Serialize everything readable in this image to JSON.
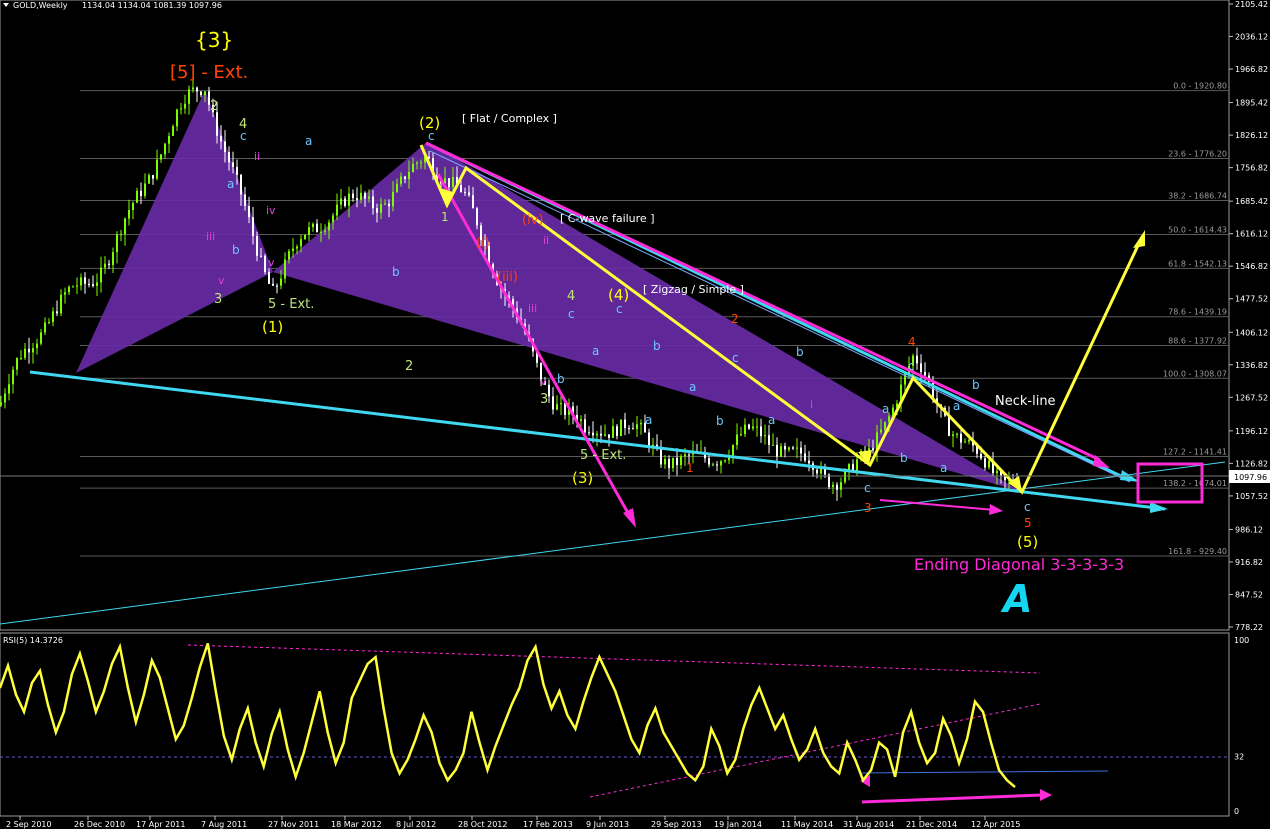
{
  "header": {
    "symbol": "GOLD,Weekly",
    "ohlc": "1134.04 1134.04 1081.39 1097.96"
  },
  "rsi_header": "RSI(5) 14.3726",
  "colors": {
    "bull": "#7CFC00",
    "fill": "#6A2BA8",
    "cyan": "#3FD8F0",
    "magenta": "#FF2AD8",
    "yellow": "#FFFF3A",
    "label_yellow": "#FFFF00",
    "label_orange": "#FF4400"
  },
  "chart_data": [
    {
      "type": "candlestick",
      "title": "GOLD,Weekly",
      "y_tick_labels": [
        "2105.42",
        "2036.12",
        "1966.82",
        "1895.42",
        "1826.12",
        "1756.82",
        "1685.42",
        "1616.12",
        "1546.82",
        "1477.52",
        "1406.12",
        "1336.82",
        "1267.52",
        "1196.12",
        "1126.82",
        "1057.52",
        "986.12",
        "916.82",
        "847.52",
        "778.22"
      ],
      "ylim": [
        778.22,
        2105.42
      ],
      "x_tick_labels": [
        "2 Sep 2010",
        "26 Dec 2010",
        "17 Apr 2011",
        "7 Aug 2011",
        "27 Nov 2011",
        "18 Mar 2012",
        "8 Jul 2012",
        "28 Oct 2012",
        "17 Feb 2013",
        "9 Jun 2013",
        "29 Sep 2013",
        "19 Jan 2014",
        "11 May 2014",
        "31 Aug 2014",
        "21 Dec 2014",
        "12 Apr 2015"
      ],
      "current_price_label": "1097.96",
      "fibonacci_levels": [
        {
          "label": "0.0 - 1920.80",
          "price": 1920.8
        },
        {
          "label": "23.6 - 1776.20",
          "price": 1776.2
        },
        {
          "label": "38.2 - 1686.74",
          "price": 1686.74
        },
        {
          "label": "50.0 - 1614.43",
          "price": 1614.43
        },
        {
          "label": "61.8 - 1542.13",
          "price": 1542.13
        },
        {
          "label": "78.6 - 1439.19",
          "price": 1439.19
        },
        {
          "label": "88.6 - 1377.92",
          "price": 1377.92
        },
        {
          "label": "100.0 - 1308.07",
          "price": 1308.07
        },
        {
          "label": "127.2 - 1141.41",
          "price": 1141.41
        },
        {
          "label": "138.2 - 1074.01",
          "price": 1074.01
        },
        {
          "label": "161.8 - 929.40",
          "price": 929.4
        }
      ],
      "swing_points": [
        {
          "date": "2 Sep 2010",
          "price": 1250
        },
        {
          "date": "7 Aug 2011",
          "price": 1920.8
        },
        {
          "date": "27 Nov 2011",
          "price": 1530
        },
        {
          "date": "8 Jul 2012",
          "price": 1796
        },
        {
          "date": "9 Jun 2013",
          "price": 1180
        },
        {
          "date": "31 Aug 2014",
          "price": 1131
        },
        {
          "date": "21 Dec 2014",
          "price": 1308
        },
        {
          "date": "12 Apr 2015",
          "price": 1081.39
        }
      ],
      "wave_labels": {
        "primary": [
          "{3}",
          "[5] - Ext."
        ],
        "intermediate": [
          "(1)",
          "(2)",
          "(3)",
          "(4)",
          "(5)"
        ],
        "pattern_notes": [
          "[ Flat / Complex ]",
          "[ C-wave failure ]",
          "[ Zigzag / Simple ]",
          "5 - Ext.",
          "5 - Ext.",
          "Neck-line",
          "Ending Diagonal 3-3-3-3-3"
        ],
        "minor": [
          "2",
          "4",
          "3",
          "ii",
          "iii",
          "iv",
          "v",
          "i",
          "a",
          "b",
          "c",
          "1",
          "3",
          "5",
          "(i)",
          "(iii)",
          "(iv)"
        ]
      }
    },
    {
      "type": "line",
      "title": "RSI(5) 14.3726",
      "y_tick_labels": [
        "100",
        "32",
        "0"
      ],
      "ylim": [
        0,
        100
      ],
      "last_value": 14.3726,
      "series": [
        {
          "name": "RSI(5)",
          "values": [
            72,
            85,
            68,
            58,
            75,
            82,
            62,
            46,
            58,
            80,
            92,
            76,
            58,
            70,
            86,
            96,
            72,
            52,
            68,
            88,
            78,
            60,
            42,
            50,
            66,
            84,
            98,
            70,
            44,
            30,
            48,
            60,
            40,
            26,
            45,
            58,
            36,
            20,
            34,
            52,
            70,
            46,
            28,
            40,
            66,
            76,
            86,
            90,
            60,
            34,
            22,
            30,
            42,
            56,
            46,
            28,
            18,
            24,
            34,
            58,
            40,
            24,
            38,
            50,
            62,
            72,
            88,
            96,
            74,
            60,
            70,
            56,
            48,
            64,
            78,
            90,
            80,
            70,
            56,
            42,
            34,
            50,
            60,
            46,
            38,
            30,
            22,
            18,
            26,
            48,
            38,
            22,
            30,
            48,
            62,
            72,
            60,
            48,
            56,
            42,
            30,
            36,
            48,
            34,
            26,
            22,
            40,
            30,
            18,
            24,
            40,
            36,
            20,
            46,
            58,
            40,
            28,
            34,
            54,
            44,
            28,
            42,
            64,
            58,
            40,
            24,
            18,
            14
          ]
        }
      ]
    }
  ],
  "brand_logo": "A"
}
